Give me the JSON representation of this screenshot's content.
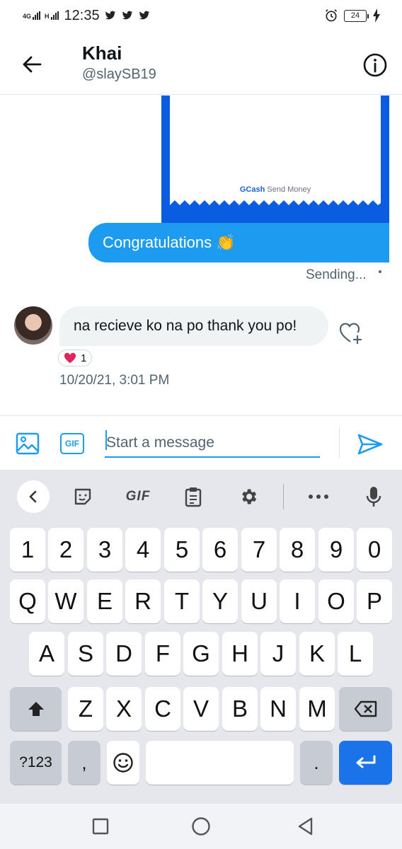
{
  "status_bar": {
    "network_1": "4G",
    "network_2": "H",
    "time": "12:35",
    "battery": "24"
  },
  "header": {
    "name": "Khai",
    "handle": "@slaySB19"
  },
  "conversation": {
    "gcash_card": {
      "brand": "GCash",
      "caption": "Send Money"
    },
    "sent_message": {
      "text": "Congratulations",
      "emoji": "👏",
      "status": "Sending..."
    },
    "received_message": {
      "text": "na recieve ko na po thank you po!",
      "reaction_count": "1",
      "timestamp": "10/20/21, 3:01 PM"
    }
  },
  "composer": {
    "gif_label": "GIF",
    "placeholder": "Start a message"
  },
  "keyboard": {
    "toolbar": {
      "gif_label": "GIF"
    },
    "row_numbers": [
      "1",
      "2",
      "3",
      "4",
      "5",
      "6",
      "7",
      "8",
      "9",
      "0"
    ],
    "row_1": [
      "Q",
      "W",
      "E",
      "R",
      "T",
      "Y",
      "U",
      "I",
      "O",
      "P"
    ],
    "row_2": [
      "A",
      "S",
      "D",
      "F",
      "G",
      "H",
      "J",
      "K",
      "L"
    ],
    "row_3": [
      "Z",
      "X",
      "C",
      "V",
      "B",
      "N",
      "M"
    ],
    "sym_label": "?123",
    "comma": ",",
    "period": "."
  },
  "colors": {
    "accent": "#1d9bf0",
    "keyboard_bg": "#e5e7ec",
    "enter_key": "#1a73e8",
    "gcash_blue": "#0a5ce0"
  }
}
